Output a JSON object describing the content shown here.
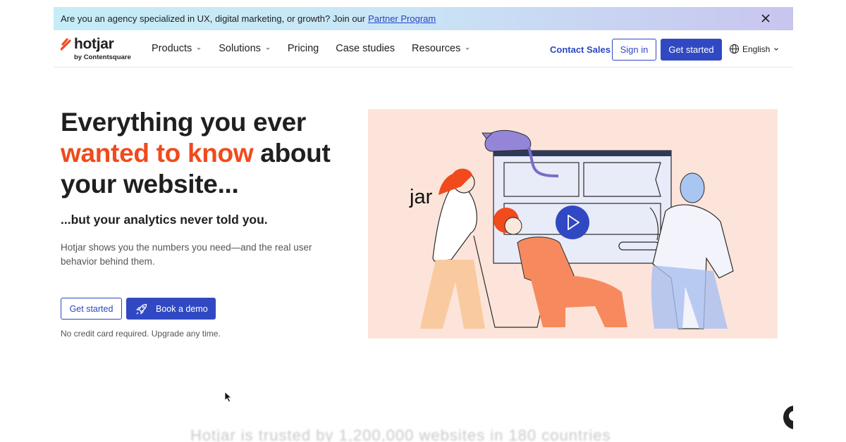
{
  "banner": {
    "text": "Are you an agency specialized in UX, digital marketing, or growth? Join our",
    "link": "Partner Program"
  },
  "brand": {
    "name": "hotjar",
    "sub": "by Contentsquare",
    "accent_color": "#f04a1d",
    "primary_color": "#3049c3"
  },
  "nav": {
    "items": [
      {
        "label": "Products",
        "has_dropdown": true
      },
      {
        "label": "Solutions",
        "has_dropdown": true
      },
      {
        "label": "Pricing",
        "has_dropdown": false
      },
      {
        "label": "Case studies",
        "has_dropdown": false
      },
      {
        "label": "Resources",
        "has_dropdown": true
      }
    ],
    "contact": "Contact Sales",
    "signin": "Sign in",
    "get_started": "Get started",
    "language": "English"
  },
  "hero": {
    "title_line1": "Everything you ever",
    "title_accent": "wanted to know",
    "title_line2_rest": " about",
    "title_line3": "your website...",
    "subtitle": "...but your analytics never told you.",
    "body": "Hotjar shows you the numbers you need—and the real user behavior behind them.",
    "btn_primary": "Get started",
    "btn_demo": "Book a demo",
    "fine_print": "No credit card required. Upgrade any time."
  },
  "illustration": {
    "overlay_text": "jar",
    "bg_color": "#fde4da"
  },
  "bottom": {
    "text": "Hotjar is trusted by 1,200,000 websites in 180 countries"
  }
}
